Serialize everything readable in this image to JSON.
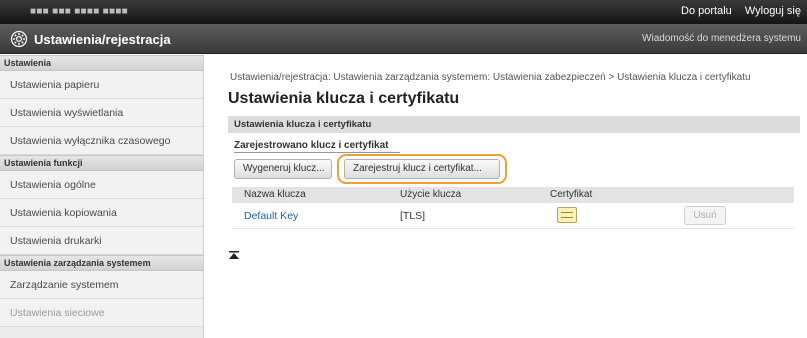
{
  "topbar": {
    "device_name": "■■■ ■■■ ■■■■ ■■■■",
    "portal_link": "Do portalu",
    "logout_link": "Wyloguj się"
  },
  "titlebar": {
    "app_title": "Ustawienia/rejestracja",
    "admin_link": "Wiadomość do menedżera systemu"
  },
  "sidebar": {
    "sections": [
      {
        "header": "Ustawienia",
        "items": [
          "Ustawienia papieru",
          "Ustawienia wyświetlania",
          "Ustawienia wyłącznika czasowego"
        ]
      },
      {
        "header": "Ustawienia funkcji",
        "items": [
          "Ustawienia ogólne",
          "Ustawienia kopiowania",
          "Ustawienia drukarki"
        ]
      },
      {
        "header": "Ustawienia zarządzania systemem",
        "items": [
          "Zarządzanie systemem",
          "Ustawienia sieciowe"
        ]
      }
    ]
  },
  "main": {
    "breadcrumb": "Ustawienia/rejestracja: Ustawienia zarządzania systemem: Ustawienia zabezpieczeń > Ustawienia klucza i certyfikatu",
    "title": "Ustawienia klucza i certyfikatu",
    "section_header": "Ustawienia klucza i certyfikatu",
    "registered_label": "Zarejestrowano klucz i certyfikat",
    "generate_button": "Wygeneruj klucz...",
    "register_button": "Zarejestruj klucz i certyfikat...",
    "table": {
      "headers": [
        "Nazwa klucza",
        "Użycie klucza",
        "Certyfikat"
      ],
      "rows": [
        {
          "key_name": "Default Key",
          "key_use": "[TLS]",
          "delete": "Usuń"
        }
      ]
    }
  },
  "colors": {
    "highlight": "#f0a030",
    "link": "#1a63b0"
  }
}
